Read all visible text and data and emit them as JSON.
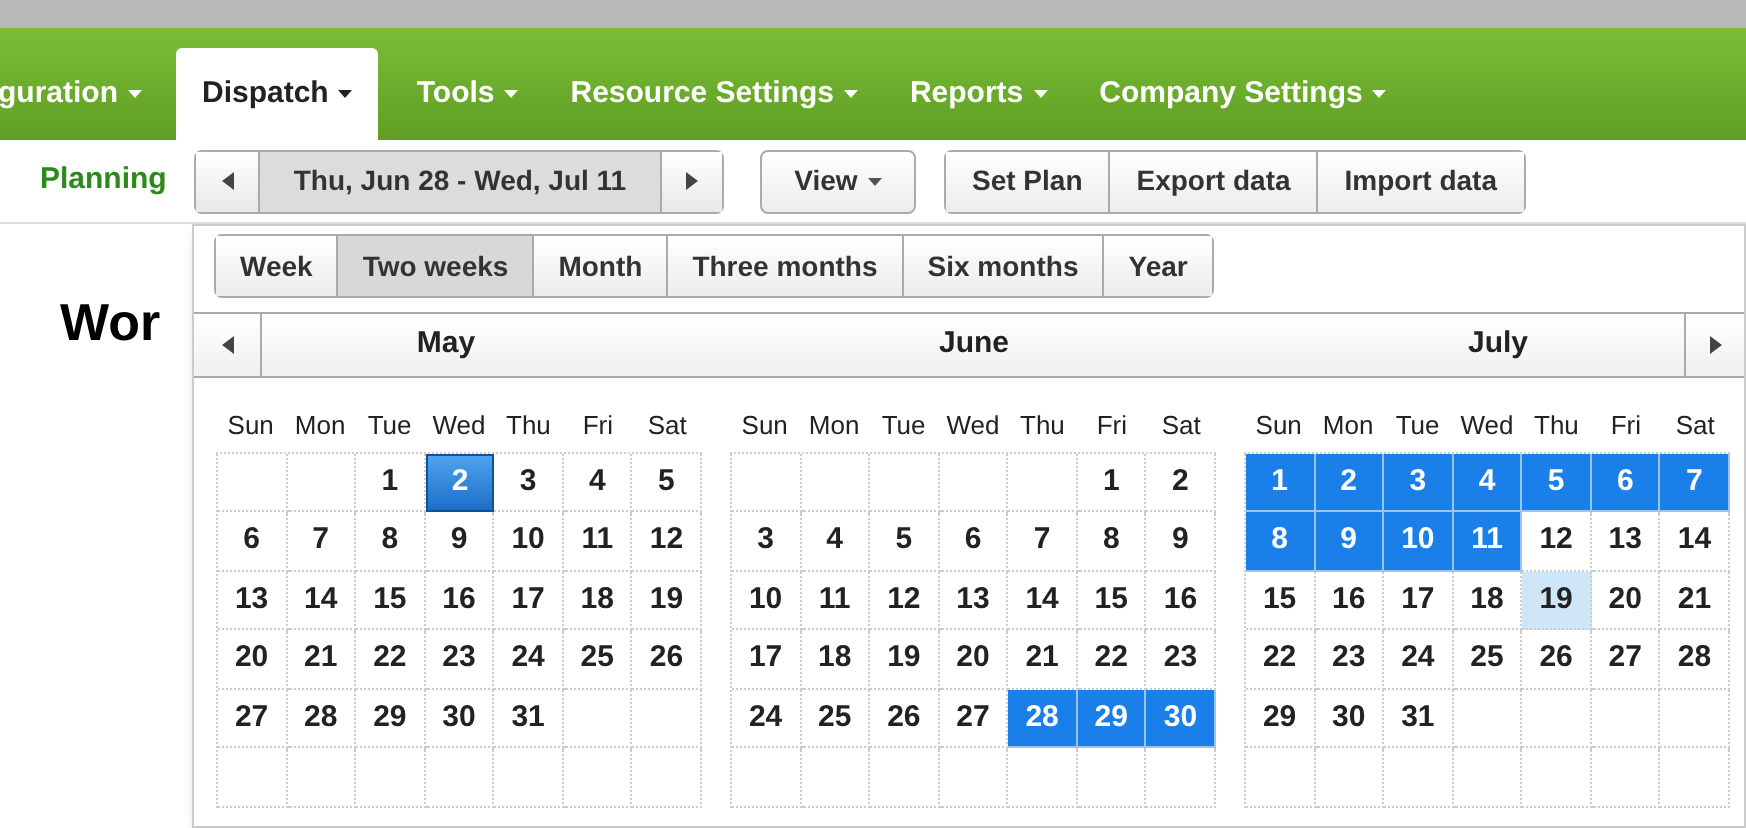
{
  "nav_tabs": [
    {
      "label": "guration",
      "selected": false
    },
    {
      "label": "Dispatch",
      "selected": true
    },
    {
      "label": "Tools",
      "selected": false
    },
    {
      "label": "Resource Settings",
      "selected": false
    },
    {
      "label": "Reports",
      "selected": false
    },
    {
      "label": "Company Settings",
      "selected": false
    }
  ],
  "planning_link": "Planning",
  "date_range": "Thu, Jun 28 - Wed, Jul 11",
  "view_button": "View",
  "action_buttons": [
    "Set Plan",
    "Export data",
    "Import data"
  ],
  "ranges": [
    {
      "label": "Week",
      "selected": false
    },
    {
      "label": "Two weeks",
      "selected": true
    },
    {
      "label": "Month",
      "selected": false
    },
    {
      "label": "Three months",
      "selected": false
    },
    {
      "label": "Six months",
      "selected": false
    },
    {
      "label": "Year",
      "selected": false
    }
  ],
  "heading": "Wor",
  "months": [
    {
      "name": "May",
      "weekdays": [
        "Sun",
        "Mon",
        "Tue",
        "Wed",
        "Thu",
        "Fri",
        "Sat"
      ],
      "cells": [
        {
          "kind": "empty"
        },
        {
          "kind": "empty"
        },
        {
          "kind": "day",
          "day": "1",
          "selected": false,
          "today": false,
          "hovered": false
        },
        {
          "kind": "day",
          "day": "2",
          "selected": false,
          "today": true,
          "hovered": false
        },
        {
          "kind": "day",
          "day": "3",
          "selected": false,
          "today": false,
          "hovered": false
        },
        {
          "kind": "day",
          "day": "4",
          "selected": false,
          "today": false,
          "hovered": false
        },
        {
          "kind": "day",
          "day": "5",
          "selected": false,
          "today": false,
          "hovered": false
        },
        {
          "kind": "day",
          "day": "6",
          "selected": false,
          "today": false,
          "hovered": false
        },
        {
          "kind": "day",
          "day": "7",
          "selected": false,
          "today": false,
          "hovered": false
        },
        {
          "kind": "day",
          "day": "8",
          "selected": false,
          "today": false,
          "hovered": false
        },
        {
          "kind": "day",
          "day": "9",
          "selected": false,
          "today": false,
          "hovered": false
        },
        {
          "kind": "day",
          "day": "10",
          "selected": false,
          "today": false,
          "hovered": false
        },
        {
          "kind": "day",
          "day": "11",
          "selected": false,
          "today": false,
          "hovered": false
        },
        {
          "kind": "day",
          "day": "12",
          "selected": false,
          "today": false,
          "hovered": false
        },
        {
          "kind": "day",
          "day": "13",
          "selected": false,
          "today": false,
          "hovered": false
        },
        {
          "kind": "day",
          "day": "14",
          "selected": false,
          "today": false,
          "hovered": false
        },
        {
          "kind": "day",
          "day": "15",
          "selected": false,
          "today": false,
          "hovered": false
        },
        {
          "kind": "day",
          "day": "16",
          "selected": false,
          "today": false,
          "hovered": false
        },
        {
          "kind": "day",
          "day": "17",
          "selected": false,
          "today": false,
          "hovered": false
        },
        {
          "kind": "day",
          "day": "18",
          "selected": false,
          "today": false,
          "hovered": false
        },
        {
          "kind": "day",
          "day": "19",
          "selected": false,
          "today": false,
          "hovered": false
        },
        {
          "kind": "day",
          "day": "20",
          "selected": false,
          "today": false,
          "hovered": false
        },
        {
          "kind": "day",
          "day": "21",
          "selected": false,
          "today": false,
          "hovered": false
        },
        {
          "kind": "day",
          "day": "22",
          "selected": false,
          "today": false,
          "hovered": false
        },
        {
          "kind": "day",
          "day": "23",
          "selected": false,
          "today": false,
          "hovered": false
        },
        {
          "kind": "day",
          "day": "24",
          "selected": false,
          "today": false,
          "hovered": false
        },
        {
          "kind": "day",
          "day": "25",
          "selected": false,
          "today": false,
          "hovered": false
        },
        {
          "kind": "day",
          "day": "26",
          "selected": false,
          "today": false,
          "hovered": false
        },
        {
          "kind": "day",
          "day": "27",
          "selected": false,
          "today": false,
          "hovered": false
        },
        {
          "kind": "day",
          "day": "28",
          "selected": false,
          "today": false,
          "hovered": false
        },
        {
          "kind": "day",
          "day": "29",
          "selected": false,
          "today": false,
          "hovered": false
        },
        {
          "kind": "day",
          "day": "30",
          "selected": false,
          "today": false,
          "hovered": false
        },
        {
          "kind": "day",
          "day": "31",
          "selected": false,
          "today": false,
          "hovered": false
        },
        {
          "kind": "empty"
        },
        {
          "kind": "empty"
        },
        {
          "kind": "empty"
        },
        {
          "kind": "empty"
        },
        {
          "kind": "empty"
        },
        {
          "kind": "empty"
        },
        {
          "kind": "empty"
        },
        {
          "kind": "empty"
        },
        {
          "kind": "empty"
        }
      ]
    },
    {
      "name": "June",
      "weekdays": [
        "Sun",
        "Mon",
        "Tue",
        "Wed",
        "Thu",
        "Fri",
        "Sat"
      ],
      "cells": [
        {
          "kind": "empty"
        },
        {
          "kind": "empty"
        },
        {
          "kind": "empty"
        },
        {
          "kind": "empty"
        },
        {
          "kind": "empty"
        },
        {
          "kind": "day",
          "day": "1",
          "selected": false,
          "today": false,
          "hovered": false
        },
        {
          "kind": "day",
          "day": "2",
          "selected": false,
          "today": false,
          "hovered": false
        },
        {
          "kind": "day",
          "day": "3",
          "selected": false,
          "today": false,
          "hovered": false
        },
        {
          "kind": "day",
          "day": "4",
          "selected": false,
          "today": false,
          "hovered": false
        },
        {
          "kind": "day",
          "day": "5",
          "selected": false,
          "today": false,
          "hovered": false
        },
        {
          "kind": "day",
          "day": "6",
          "selected": false,
          "today": false,
          "hovered": false
        },
        {
          "kind": "day",
          "day": "7",
          "selected": false,
          "today": false,
          "hovered": false
        },
        {
          "kind": "day",
          "day": "8",
          "selected": false,
          "today": false,
          "hovered": false
        },
        {
          "kind": "day",
          "day": "9",
          "selected": false,
          "today": false,
          "hovered": false
        },
        {
          "kind": "day",
          "day": "10",
          "selected": false,
          "today": false,
          "hovered": false
        },
        {
          "kind": "day",
          "day": "11",
          "selected": false,
          "today": false,
          "hovered": false
        },
        {
          "kind": "day",
          "day": "12",
          "selected": false,
          "today": false,
          "hovered": false
        },
        {
          "kind": "day",
          "day": "13",
          "selected": false,
          "today": false,
          "hovered": false
        },
        {
          "kind": "day",
          "day": "14",
          "selected": false,
          "today": false,
          "hovered": false
        },
        {
          "kind": "day",
          "day": "15",
          "selected": false,
          "today": false,
          "hovered": false
        },
        {
          "kind": "day",
          "day": "16",
          "selected": false,
          "today": false,
          "hovered": false
        },
        {
          "kind": "day",
          "day": "17",
          "selected": false,
          "today": false,
          "hovered": false
        },
        {
          "kind": "day",
          "day": "18",
          "selected": false,
          "today": false,
          "hovered": false
        },
        {
          "kind": "day",
          "day": "19",
          "selected": false,
          "today": false,
          "hovered": false
        },
        {
          "kind": "day",
          "day": "20",
          "selected": false,
          "today": false,
          "hovered": false
        },
        {
          "kind": "day",
          "day": "21",
          "selected": false,
          "today": false,
          "hovered": false
        },
        {
          "kind": "day",
          "day": "22",
          "selected": false,
          "today": false,
          "hovered": false
        },
        {
          "kind": "day",
          "day": "23",
          "selected": false,
          "today": false,
          "hovered": false
        },
        {
          "kind": "day",
          "day": "24",
          "selected": false,
          "today": false,
          "hovered": false
        },
        {
          "kind": "day",
          "day": "25",
          "selected": false,
          "today": false,
          "hovered": false
        },
        {
          "kind": "day",
          "day": "26",
          "selected": false,
          "today": false,
          "hovered": false
        },
        {
          "kind": "day",
          "day": "27",
          "selected": false,
          "today": false,
          "hovered": false
        },
        {
          "kind": "day",
          "day": "28",
          "selected": true,
          "today": false,
          "hovered": false
        },
        {
          "kind": "day",
          "day": "29",
          "selected": true,
          "today": false,
          "hovered": false
        },
        {
          "kind": "day",
          "day": "30",
          "selected": true,
          "today": false,
          "hovered": false
        },
        {
          "kind": "empty"
        },
        {
          "kind": "empty"
        },
        {
          "kind": "empty"
        },
        {
          "kind": "empty"
        },
        {
          "kind": "empty"
        },
        {
          "kind": "empty"
        },
        {
          "kind": "empty"
        }
      ]
    },
    {
      "name": "July",
      "weekdays": [
        "Sun",
        "Mon",
        "Tue",
        "Wed",
        "Thu",
        "Fri",
        "Sat"
      ],
      "cells": [
        {
          "kind": "day",
          "day": "1",
          "selected": true,
          "today": false,
          "hovered": false
        },
        {
          "kind": "day",
          "day": "2",
          "selected": true,
          "today": false,
          "hovered": false
        },
        {
          "kind": "day",
          "day": "3",
          "selected": true,
          "today": false,
          "hovered": false
        },
        {
          "kind": "day",
          "day": "4",
          "selected": true,
          "today": false,
          "hovered": false
        },
        {
          "kind": "day",
          "day": "5",
          "selected": true,
          "today": false,
          "hovered": false
        },
        {
          "kind": "day",
          "day": "6",
          "selected": true,
          "today": false,
          "hovered": false
        },
        {
          "kind": "day",
          "day": "7",
          "selected": true,
          "today": false,
          "hovered": false
        },
        {
          "kind": "day",
          "day": "8",
          "selected": true,
          "today": false,
          "hovered": false
        },
        {
          "kind": "day",
          "day": "9",
          "selected": true,
          "today": false,
          "hovered": false
        },
        {
          "kind": "day",
          "day": "10",
          "selected": true,
          "today": false,
          "hovered": false
        },
        {
          "kind": "day",
          "day": "11",
          "selected": true,
          "today": false,
          "hovered": false
        },
        {
          "kind": "day",
          "day": "12",
          "selected": false,
          "today": false,
          "hovered": false
        },
        {
          "kind": "day",
          "day": "13",
          "selected": false,
          "today": false,
          "hovered": false
        },
        {
          "kind": "day",
          "day": "14",
          "selected": false,
          "today": false,
          "hovered": false
        },
        {
          "kind": "day",
          "day": "15",
          "selected": false,
          "today": false,
          "hovered": false
        },
        {
          "kind": "day",
          "day": "16",
          "selected": false,
          "today": false,
          "hovered": false
        },
        {
          "kind": "day",
          "day": "17",
          "selected": false,
          "today": false,
          "hovered": false
        },
        {
          "kind": "day",
          "day": "18",
          "selected": false,
          "today": false,
          "hovered": false
        },
        {
          "kind": "day",
          "day": "19",
          "selected": false,
          "today": false,
          "hovered": true
        },
        {
          "kind": "day",
          "day": "20",
          "selected": false,
          "today": false,
          "hovered": false
        },
        {
          "kind": "day",
          "day": "21",
          "selected": false,
          "today": false,
          "hovered": false
        },
        {
          "kind": "day",
          "day": "22",
          "selected": false,
          "today": false,
          "hovered": false
        },
        {
          "kind": "day",
          "day": "23",
          "selected": false,
          "today": false,
          "hovered": false
        },
        {
          "kind": "day",
          "day": "24",
          "selected": false,
          "today": false,
          "hovered": false
        },
        {
          "kind": "day",
          "day": "25",
          "selected": false,
          "today": false,
          "hovered": false
        },
        {
          "kind": "day",
          "day": "26",
          "selected": false,
          "today": false,
          "hovered": false
        },
        {
          "kind": "day",
          "day": "27",
          "selected": false,
          "today": false,
          "hovered": false
        },
        {
          "kind": "day",
          "day": "28",
          "selected": false,
          "today": false,
          "hovered": false
        },
        {
          "kind": "day",
          "day": "29",
          "selected": false,
          "today": false,
          "hovered": false
        },
        {
          "kind": "day",
          "day": "30",
          "selected": false,
          "today": false,
          "hovered": false
        },
        {
          "kind": "day",
          "day": "31",
          "selected": false,
          "today": false,
          "hovered": false
        },
        {
          "kind": "empty"
        },
        {
          "kind": "empty"
        },
        {
          "kind": "empty"
        },
        {
          "kind": "empty"
        },
        {
          "kind": "empty"
        },
        {
          "kind": "empty"
        },
        {
          "kind": "empty"
        },
        {
          "kind": "empty"
        },
        {
          "kind": "empty"
        },
        {
          "kind": "empty"
        },
        {
          "kind": "empty"
        }
      ]
    }
  ]
}
